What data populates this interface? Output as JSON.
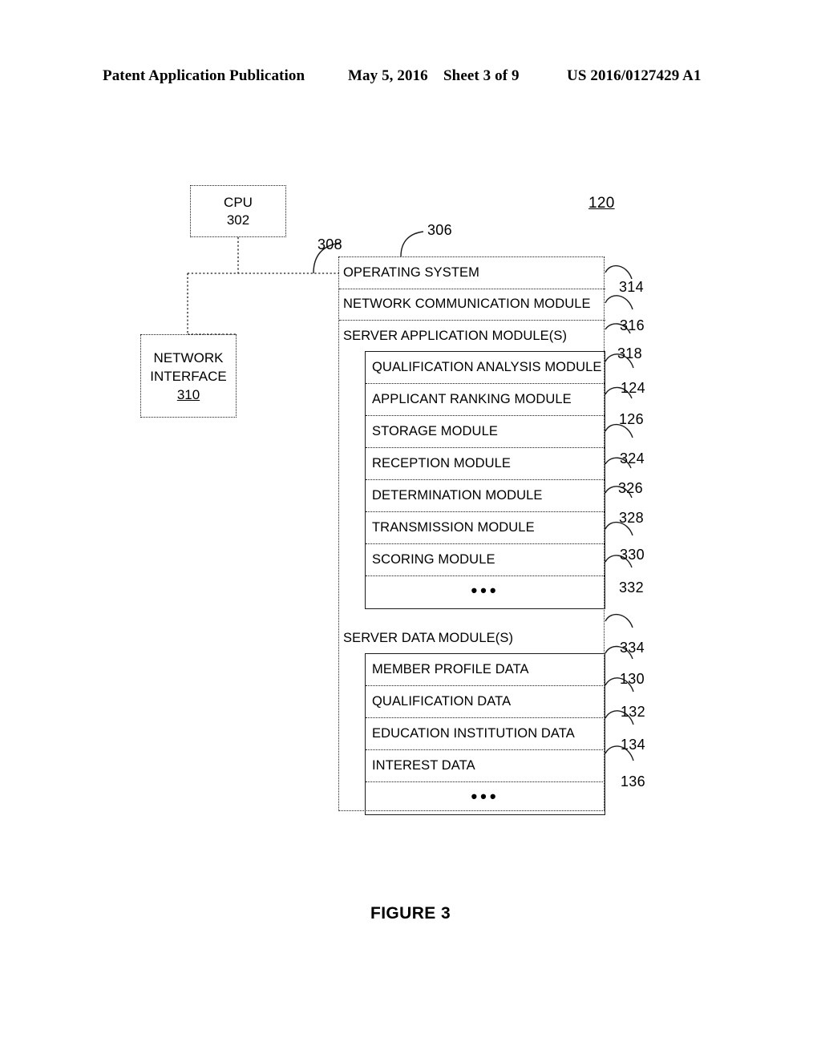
{
  "header": {
    "publication": "Patent Application Publication",
    "date": "May 5, 2016",
    "sheet": "Sheet 3 of 9",
    "patent_number": "US 2016/0127429 A1"
  },
  "figure": {
    "caption": "FIGURE 3",
    "system_ref": "120"
  },
  "blocks": {
    "cpu": {
      "label": "CPU",
      "ref": "302"
    },
    "network_interface": {
      "line1": "NETWORK",
      "line2": "INTERFACE",
      "ref": "310"
    },
    "bus": {
      "ref": "308"
    },
    "memory": {
      "ref": "306"
    }
  },
  "memory_rows": [
    {
      "label": "OPERATING SYSTEM",
      "ref": "314"
    },
    {
      "label": "NETWORK COMMUNICATION MODULE",
      "ref": "316"
    },
    {
      "label": "SERVER APPLICATION MODULE(S)",
      "ref": "318"
    }
  ],
  "application_modules": [
    {
      "label": "QUALIFICATION ANALYSIS MODULE",
      "ref": "124"
    },
    {
      "label": "APPLICANT RANKING MODULE",
      "ref": "126"
    },
    {
      "label": "STORAGE MODULE",
      "ref": "324"
    },
    {
      "label": "RECEPTION MODULE",
      "ref": "326"
    },
    {
      "label": "DETERMINATION MODULE",
      "ref": "328"
    },
    {
      "label": "TRANSMISSION MODULE",
      "ref": "330"
    },
    {
      "label": "SCORING MODULE",
      "ref": "332"
    },
    {
      "label": "•••",
      "ref": ""
    }
  ],
  "data_section": {
    "label": "SERVER DATA MODULE(S)",
    "ref": "334"
  },
  "data_modules": [
    {
      "label": "MEMBER PROFILE DATA",
      "ref": "130"
    },
    {
      "label": "QUALIFICATION DATA",
      "ref": "132"
    },
    {
      "label": "EDUCATION INSTITUTION DATA",
      "ref": "134"
    },
    {
      "label": "INTEREST DATA",
      "ref": "136"
    },
    {
      "label": "•••",
      "ref": ""
    }
  ],
  "style": {
    "ink": "#1a1a1a",
    "paper": "#ffffff"
  }
}
